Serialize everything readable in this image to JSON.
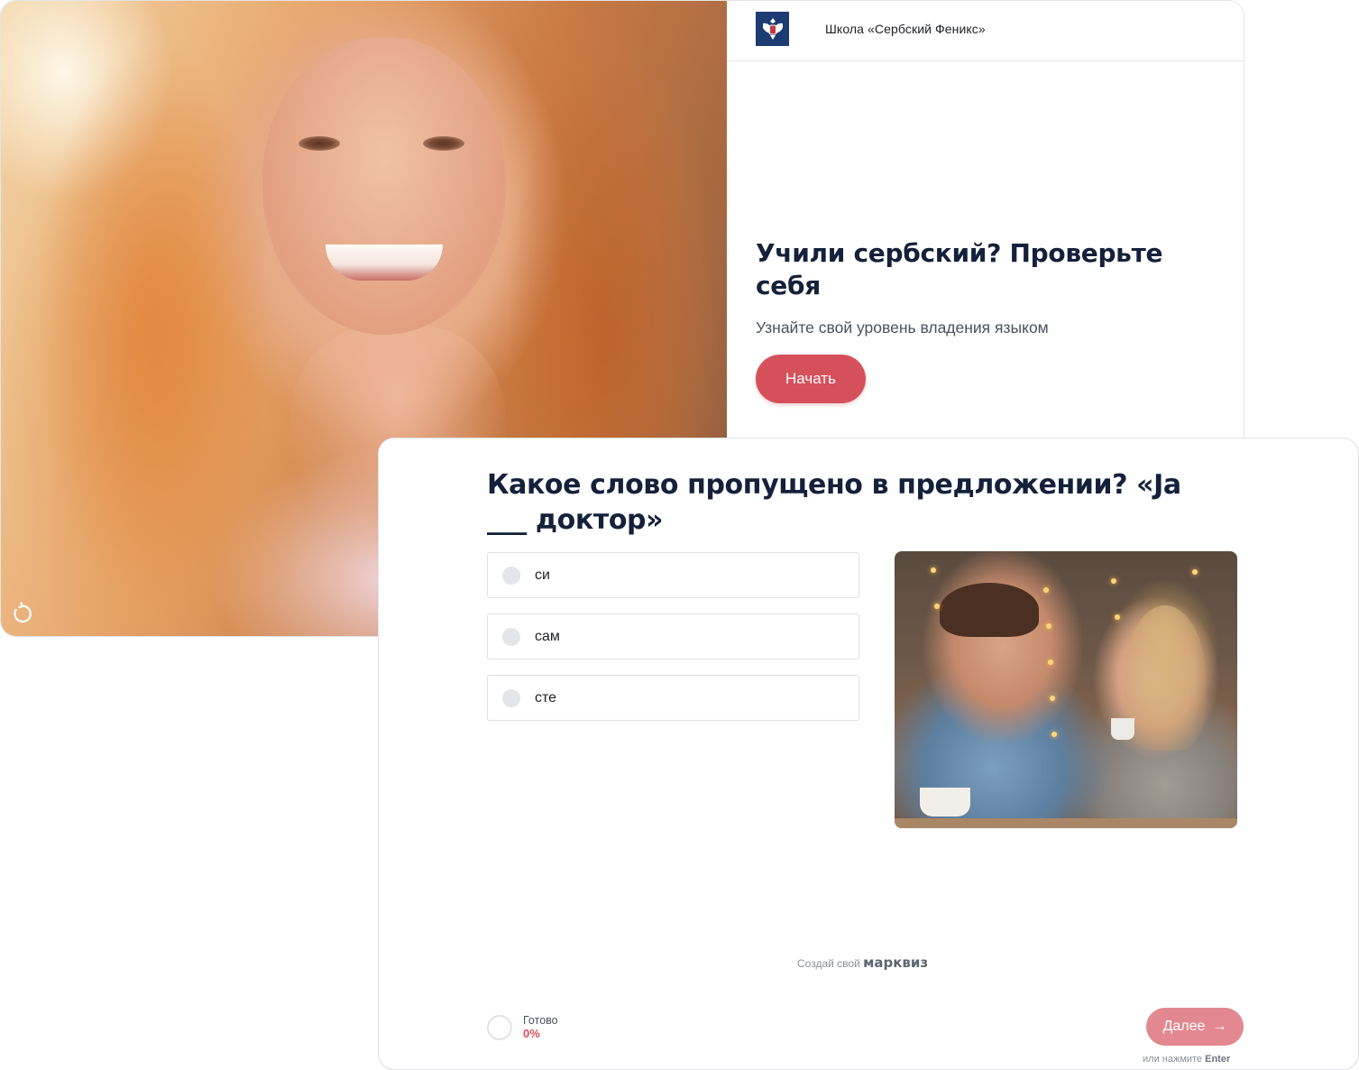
{
  "start_screen": {
    "school_name": "Школа «Сербский Феникс»",
    "title": "Учили сербский? Проверьте себя",
    "subtitle": "Узнайте свой уровень владения языком",
    "start_button": "Начать",
    "logo_icon": "eagle-crest-icon",
    "refresh_icon": "refresh-icon"
  },
  "question_screen": {
    "question": "Какое слово пропущено в предложении? «Ja ___ доктор»",
    "options": [
      {
        "label": "си"
      },
      {
        "label": "сам"
      },
      {
        "label": "сте"
      }
    ],
    "made_with_prefix": "Создай свой",
    "made_with_brand": "марквиз",
    "progress": {
      "label": "Готово",
      "value": "0%"
    },
    "next_button": "Далее",
    "next_arrow": "→",
    "enter_hint_prefix": "или нажмите",
    "enter_hint_key": "Enter"
  },
  "colors": {
    "accent": "#d5505b",
    "accent_disabled": "#e38890",
    "title": "#14213a",
    "logo_bg": "#1c3b72"
  }
}
